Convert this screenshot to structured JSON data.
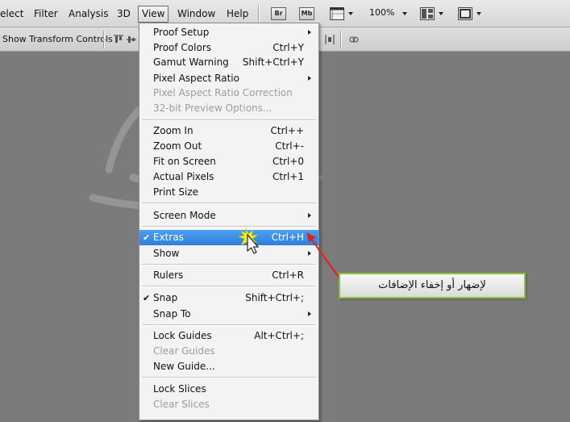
{
  "menubar": {
    "items": [
      {
        "label": "elect"
      },
      {
        "label": "Filter"
      },
      {
        "label": "Analysis"
      },
      {
        "label": "3D"
      },
      {
        "label": "View"
      },
      {
        "label": "Window"
      },
      {
        "label": "Help"
      }
    ],
    "bridge_label": "Br",
    "minibridge_label": "Mb",
    "zoom_value": "100%"
  },
  "options_bar": {
    "show_transform_controls": "Show Transform Controls"
  },
  "view_menu": {
    "groups": [
      [
        {
          "label": "Proof Setup",
          "shortcut": "",
          "submenu": true,
          "disabled": false,
          "checked": false
        },
        {
          "label": "Proof Colors",
          "shortcut": "Ctrl+Y",
          "submenu": false,
          "disabled": false,
          "checked": false
        },
        {
          "label": "Gamut Warning",
          "shortcut": "Shift+Ctrl+Y",
          "submenu": false,
          "disabled": false,
          "checked": false
        },
        {
          "label": "Pixel Aspect Ratio",
          "shortcut": "",
          "submenu": true,
          "disabled": false,
          "checked": false
        },
        {
          "label": "Pixel Aspect Ratio Correction",
          "shortcut": "",
          "submenu": false,
          "disabled": true,
          "checked": false
        },
        {
          "label": "32-bit Preview Options...",
          "shortcut": "",
          "submenu": false,
          "disabled": true,
          "checked": false
        }
      ],
      [
        {
          "label": "Zoom In",
          "shortcut": "Ctrl++",
          "submenu": false,
          "disabled": false,
          "checked": false
        },
        {
          "label": "Zoom Out",
          "shortcut": "Ctrl+-",
          "submenu": false,
          "disabled": false,
          "checked": false
        },
        {
          "label": "Fit on Screen",
          "shortcut": "Ctrl+0",
          "submenu": false,
          "disabled": false,
          "checked": false
        },
        {
          "label": "Actual Pixels",
          "shortcut": "Ctrl+1",
          "submenu": false,
          "disabled": false,
          "checked": false
        },
        {
          "label": "Print Size",
          "shortcut": "",
          "submenu": false,
          "disabled": false,
          "checked": false
        }
      ],
      [
        {
          "label": "Screen Mode",
          "shortcut": "",
          "submenu": true,
          "disabled": false,
          "checked": false
        }
      ],
      [
        {
          "label": "Extras",
          "shortcut": "Ctrl+H",
          "submenu": false,
          "disabled": false,
          "checked": true,
          "highlighted": true
        },
        {
          "label": "Show",
          "shortcut": "",
          "submenu": true,
          "disabled": false,
          "checked": false
        }
      ],
      [
        {
          "label": "Rulers",
          "shortcut": "Ctrl+R",
          "submenu": false,
          "disabled": false,
          "checked": false
        }
      ],
      [
        {
          "label": "Snap",
          "shortcut": "Shift+Ctrl+;",
          "submenu": false,
          "disabled": false,
          "checked": true
        },
        {
          "label": "Snap To",
          "shortcut": "",
          "submenu": true,
          "disabled": false,
          "checked": false
        }
      ],
      [
        {
          "label": "Lock Guides",
          "shortcut": "Alt+Ctrl+;",
          "submenu": false,
          "disabled": false,
          "checked": false
        },
        {
          "label": "Clear Guides",
          "shortcut": "",
          "submenu": false,
          "disabled": true,
          "checked": false
        },
        {
          "label": "New Guide...",
          "shortcut": "",
          "submenu": false,
          "disabled": false,
          "checked": false
        }
      ],
      [
        {
          "label": "Lock Slices",
          "shortcut": "",
          "submenu": false,
          "disabled": false,
          "checked": false
        },
        {
          "label": "Clear Slices",
          "shortcut": "",
          "submenu": false,
          "disabled": true,
          "checked": false
        }
      ]
    ]
  },
  "callout": {
    "text": "لإضهار أو إخفاء الإضافات"
  },
  "colors": {
    "highlight": "#3b8fe6",
    "callout_border": "#8fbf3c",
    "arrow": "#e02020"
  }
}
